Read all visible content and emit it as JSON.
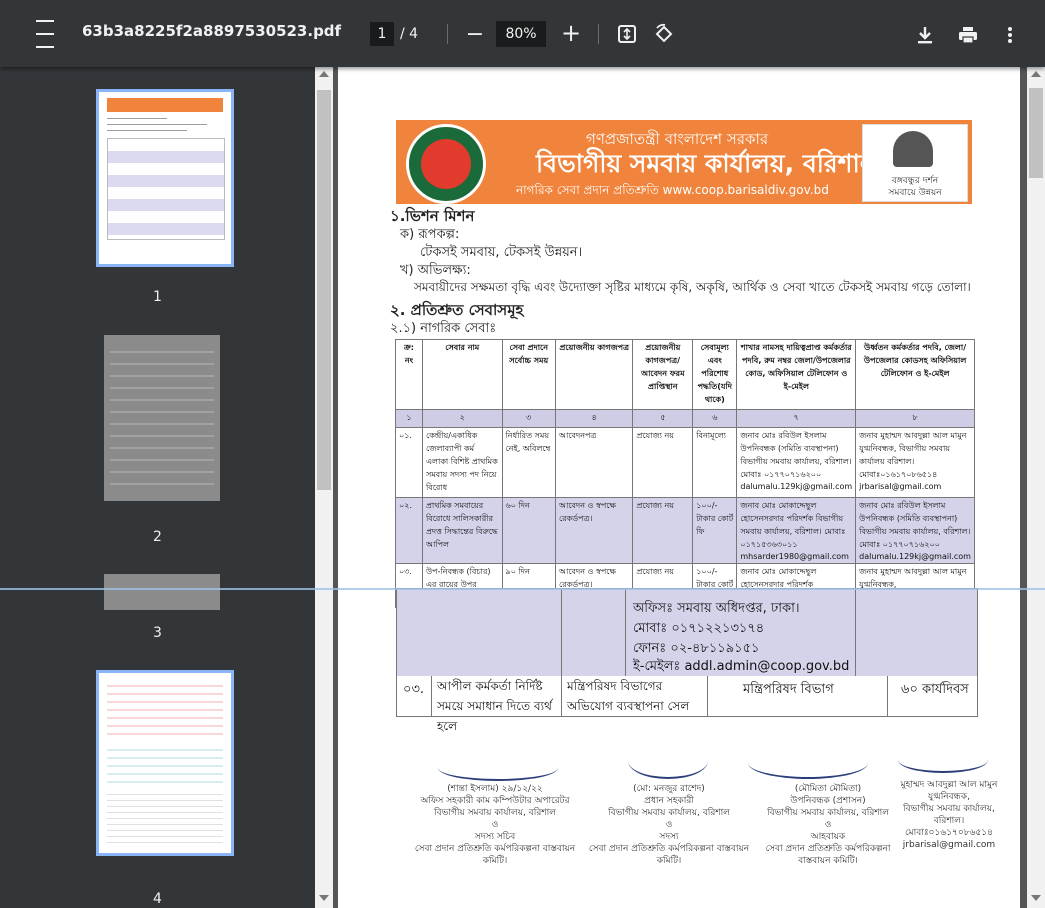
{
  "toolbar": {
    "title": "63b3a8225f2a8897530523.pdf",
    "current_page": "1",
    "page_sep": "/",
    "total_pages": "4",
    "zoom_minus": "−",
    "zoom": "80%",
    "zoom_plus": "+"
  },
  "icons": [
    "menu-icon",
    "zoom-out-icon",
    "zoom-in-icon",
    "fit-page-icon",
    "rotate-icon",
    "download-icon",
    "print-icon",
    "more-vert-icon"
  ],
  "thumbnails": [
    {
      "label": "1"
    },
    {
      "label": "2"
    },
    {
      "label": "3"
    },
    {
      "label": "4"
    }
  ],
  "doc": {
    "banner_line1": "গণপ্রজাতন্ত্রী বাংলাদেশ সরকার",
    "banner_line2": "বিভাগীয় সমবায় কার্যালয়, বরিশাল",
    "banner_line3": "নাগরিক সেবা প্রদান প্রতিশ্রুতি   www.coop.barisaldiv.gov.bd",
    "badge_line1": "বঙ্গবন্ধুর দর্শন",
    "badge_line2": "সমবায়ে উন্নয়ন",
    "s1_title": "১.ভিশন মিশন",
    "s1_a": "ক) রূপকল্প:",
    "s1_a_text": "টেকসই সমবায়, টেকসই উন্নয়ন।",
    "s1_b": "খ) অভিলক্ষ্য:",
    "s1_b_text": "সমবায়ীদের সক্ষমতা বৃদ্ধি এবং উদ্যোক্তা সৃষ্টির মাধ্যমে কৃষি, অকৃষি, আর্থিক ও সেবা খাতে টেকসই সমবায় গড়ে তোলা।",
    "s2_title": "২. প্রতিশ্রুত সেবাসমূহ",
    "s2_sub": "২.১) নাগরিক সেবাঃ",
    "table_headers": [
      "ক্র: নং",
      "সেবার নাম",
      "সেবা প্রদানে সর্বোচ্চ সময়",
      "প্রয়োজনীয় কাগজপত্র",
      "প্রয়োজনীয় কাগজপত্র/আবেদন ফরম প্রাপ্তিস্থান",
      "সেবামূল্য এবং পরিশোধ পদ্ধতি(যদি থাকে)",
      "শাখার নামসহ দায়িত্বপ্রাপ্ত কর্মকর্তার পদবি, রুম নম্বর জেলা/উপজেলার কোড, অফিসিয়াল টেলিফোন ও ই-মেইল",
      "উর্ধ্বতন কর্মকর্তার পদবি, জেলা/উপজেলার কোডসহ অফিসিয়াল টেলিফোন ও ই-মেইল"
    ],
    "table_nums": [
      "১",
      "২",
      "৩",
      "৪",
      "৫",
      "৬",
      "৭",
      "৮"
    ],
    "rows": [
      [
        "০১.",
        "কেন্দ্রীয়/একাধিক জেলাব্যাপী কর্ম এলাকা বিশিষ্ট প্রাথমিক সমবায় সদস্য পদ নিয়ে বিরোধ",
        "নির্ধারিত সময় নেই, অবিলম্বে",
        "আবেদনপত্র",
        "প্রযোজ্য নয়",
        "বিনামূল্যে",
        "জনাব মোঃ রবিউল ইসলাম উপনিবন্ধক (সমিতি ব্যবস্থাপনা) বিভাগীয় সমবায় কার্যালয়, বরিশাল। মোবাঃ ০১৭৭০৭১৬২০০ dalumalu.129kj@gmail.com",
        "জনাব মুহাম্মদ আবদুল্লা আল মামুন যুগ্মনিবন্ধক, বিভাগীয় সমবায় কার্যালয় বরিশাল। মোবাঃ০১৬১৭০৮৬৫১৪ jrbarisal@gmail.com"
      ],
      [
        "০২.",
        "প্রাথমিক সমবায়ের বিরোধে সালিসকারীর প্রদত্ত সিদ্ধান্তের বিরুদ্ধে আপিল",
        "৬০ দিন",
        "আবেদন ও স্বপক্ষে রেকর্ডপত্র।",
        "প্রযোজ্য নয়",
        "১০০/- টাকার কোর্ট ফি",
        "জনাব মোঃ মোকাদ্দেছুল হোসেনসরদার পরিদর্শক বিভাগীয় সমবায় কার্যালয়, বরিশাল। মোবাঃ ০১৭১৫৩৬৩০১১ mhsarder1980@gmail.com",
        "জনাব মোঃ রবিউল ইসলাম উপনিবন্ধক (সমিতি ব্যবস্থাপনা) বিভাগীয় সমবায় কার্যালয়, বরিশাল। মোবাঃ ০১৭৭০৭১৬২০০ dalumalu.129kj@gmail.com"
      ],
      [
        "০৩.",
        "উপ-নিবন্ধক (বিচার) এর রায়ের উপর আপীল",
        "৯০ দিন",
        "আবেদন ও স্বপক্ষে রেকর্ডপত্র।",
        "প্রযোজ্য নয়",
        "১০০/- টাকার কোর্ট",
        "জনাব মোঃ মোকাদ্দেছুল হোসেনসরদার পরিদর্শক",
        "জনাব মুহাম্মদ আবদুল্লা আল মামুন যুগ্মনিবন্ধক,"
      ]
    ],
    "lower_lines": [
      "অফিসঃ সমবায় অধিদপ্তর, ঢাকা।",
      "মোবাঃ ০১৭১২২১৩১৭৪",
      "ফোনঃ ০২-৪৮১১৯১৫১",
      "ই-মেইলঃ addl.admin@coop.gov.bd"
    ],
    "lower_row": [
      "০৩.",
      "আপীল কর্মকর্তা নির্দিষ্ট সময়ে সমাধান দিতে ব্যর্থ হলে",
      "মন্ত্রিপরিষদ বিভাগের অভিযোগ ব্যবস্থাপনা সেল",
      "মন্ত্রিপরিষদ বিভাগ",
      "৬০ কার্যদিবস"
    ],
    "signatures": [
      {
        "name": "(শান্তা ইসলাম) ২৯/১২/২২",
        "lines": [
          "অফিস সহকারী কাম কম্পিউটার অপারেটর",
          "বিভাগীয় সমবায় কার্যালয়, বরিশাল",
          "ও",
          "সদস্য সচিব",
          "সেবা প্রদান প্রতিশ্রুতি কর্মপরিকল্পনা বাস্তবায়ন কমিটি।"
        ]
      },
      {
        "name": "(মো: মনজুর রাশেদ)",
        "lines": [
          "প্রধান সহকারী",
          "বিভাগীয় সমবায় কার্যালয়, বরিশাল",
          "ও",
          "সদস্য",
          "সেবা প্রদান প্রতিশ্রুতি কর্মপরিকল্পনা বাস্তবায়ন কমিটি।"
        ]
      },
      {
        "name": "(মৌমিতা মৌমিতা)",
        "lines": [
          "উপনিবন্ধক (প্রশাসন)",
          "বিভাগীয় সমবায় কার্যালয়, বরিশাল",
          "ও",
          "আহবায়ক",
          "সেবা প্রদান প্রতিশ্রুতি কর্মপরিকল্পনা বাস্তবায়ন কমিটি।"
        ]
      },
      {
        "name": "মুহাম্মদ আবদুল্লা আল মামুন",
        "lines": [
          "যুগ্মনিবন্ধক,",
          "বিভাগীয় সমবায় কার্যালয়,",
          "বরিশাল।",
          "মোবাঃ০১৬১৭০৮৬৫১৪",
          "jrbarisal@gmail.com"
        ]
      }
    ]
  }
}
